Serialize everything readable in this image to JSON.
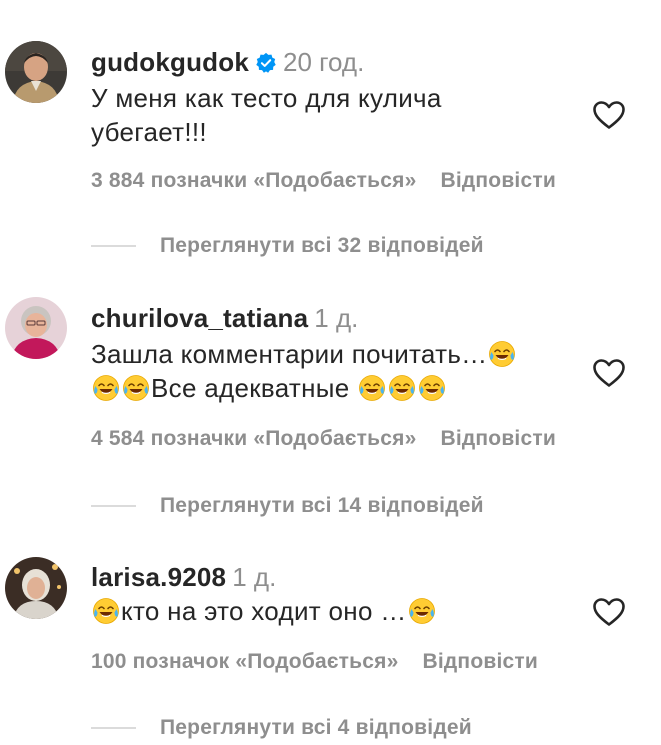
{
  "comments": [
    {
      "username": "gudokgudok",
      "verified": true,
      "time": "20 год.",
      "lines": [
        [
          {
            "t": "text",
            "v": "У меня как тесто для кулича"
          }
        ],
        [
          {
            "t": "text",
            "v": "убегает!!!"
          }
        ]
      ],
      "likes": "3 884 позначки «Подобається»",
      "reply_label": "Відповісти",
      "view_replies": "Переглянути всі 32 відповідей",
      "avatar_icon": "avatar-man-icon"
    },
    {
      "username": "churilova_tatiana",
      "verified": false,
      "time": "1 д.",
      "lines": [
        [
          {
            "t": "text",
            "v": "Зашла комментарии почитать…"
          },
          {
            "t": "emoji"
          }
        ],
        [
          {
            "t": "emoji"
          },
          {
            "t": "emoji"
          },
          {
            "t": "text",
            "v": "Все адекватные "
          },
          {
            "t": "emoji"
          },
          {
            "t": "emoji"
          },
          {
            "t": "emoji"
          }
        ]
      ],
      "likes": "4 584 позначки «Подобається»",
      "reply_label": "Відповісти",
      "view_replies": "Переглянути всі 14 відповідей",
      "avatar_icon": "avatar-woman-icon"
    },
    {
      "username": "larisa.9208",
      "verified": false,
      "time": "1 д.",
      "lines": [
        [
          {
            "t": "emoji"
          },
          {
            "t": "text",
            "v": "кто на это ходит оно …"
          },
          {
            "t": "emoji"
          }
        ]
      ],
      "likes": "100 позначок «Подобається»",
      "reply_label": "Відповісти",
      "view_replies": "Переглянути всі 4 відповідей",
      "avatar_icon": "avatar-woman-icon"
    }
  ],
  "icons": {
    "emoji": "face-with-tears-of-joy-icon",
    "like": "heart-outline-icon",
    "verified": "verified-badge-icon"
  },
  "colors": {
    "text": "#262626",
    "secondary": "#8e8e8e",
    "verified": "#0095f6",
    "divider": "#dbdbdb"
  }
}
